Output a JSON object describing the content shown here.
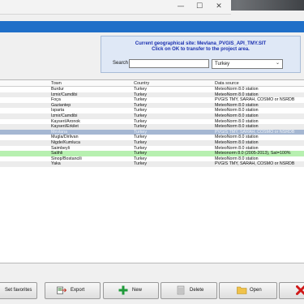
{
  "window": {
    "minimize_glyph": "—",
    "maximize_glyph": "☐",
    "close_glyph": "✕"
  },
  "info": {
    "line1": "Current geographical site: Mevlana_PVGIS_API_TMY.SIT",
    "line2": "Click on OK to transfer to the project area.",
    "search_label": "Search",
    "search_value": "",
    "country_value": "Turkey",
    "country_chevron": "⌄"
  },
  "table": {
    "headers": {
      "town": "Town",
      "country": "Country",
      "source": "Data source"
    },
    "rows": [
      {
        "town": "Burdur",
        "country": "Turkey",
        "source": "MeteoNorm 8.0 station",
        "style": ""
      },
      {
        "town": "Izmir/Camdibi",
        "country": "Turkey",
        "source": "MeteoNorm 8.0 station",
        "style": "alt"
      },
      {
        "town": "Foça",
        "country": "Turkey",
        "source": "PVGIS TMY, SARAH, COSMO or NSRDB",
        "style": ""
      },
      {
        "town": "Gaziantep",
        "country": "Turkey",
        "source": "MeteoNorm 8.0 station",
        "style": "alt"
      },
      {
        "town": "Isparta",
        "country": "Turkey",
        "source": "MeteoNorm 8.0 station",
        "style": ""
      },
      {
        "town": "Izmir/Camdibi",
        "country": "Turkey",
        "source": "MeteoNorm 8.0 station",
        "style": "alt"
      },
      {
        "town": "Kayseri/Aronok",
        "country": "Turkey",
        "source": "MeteoNorm 8.0 station",
        "style": ""
      },
      {
        "town": "Kayseri/Erkilet",
        "country": "Turkey",
        "source": "MeteoNorm 8.0 station",
        "style": "alt"
      },
      {
        "town": "Mevlana",
        "country": "Turkey",
        "source": "PVGIS TMY, SARAH, COSMO or NSRDB",
        "style": "sel"
      },
      {
        "town": "Mugla/Dirlivan",
        "country": "Turkey",
        "source": "MeteoNorm 8.0 station",
        "style": ""
      },
      {
        "town": "Nigde/Kumluca",
        "country": "Turkey",
        "source": "MeteoNorm 8.0 station",
        "style": "alt"
      },
      {
        "town": "Saimbeyli",
        "country": "Turkey",
        "source": "MeteoNorm 8.0 station",
        "style": ""
      },
      {
        "town": "Salihli",
        "country": "Turkey",
        "source": "Meteonorm 8.0 (2005-2013), Sat=100%",
        "style": "green"
      },
      {
        "town": "Sinop/Bostancili",
        "country": "Turkey",
        "source": "MeteoNorm 8.0 station",
        "style": ""
      },
      {
        "town": "Yaka",
        "country": "Turkey",
        "source": "PVGIS TMY, SARAH, COSMO or NSRDB",
        "style": "alt"
      }
    ]
  },
  "buttons": {
    "favorites": "Set favorites",
    "export": "Export",
    "new": "New",
    "delete": "Delete",
    "open": "Open"
  },
  "colors": {
    "accent_blue": "#1f6fc8",
    "info_text": "#1a2fb0",
    "selected_row": "#a5b7d2",
    "highlight_row": "#b7f0b0",
    "delete_red": "#d01818",
    "new_green": "#1f9a3a"
  }
}
